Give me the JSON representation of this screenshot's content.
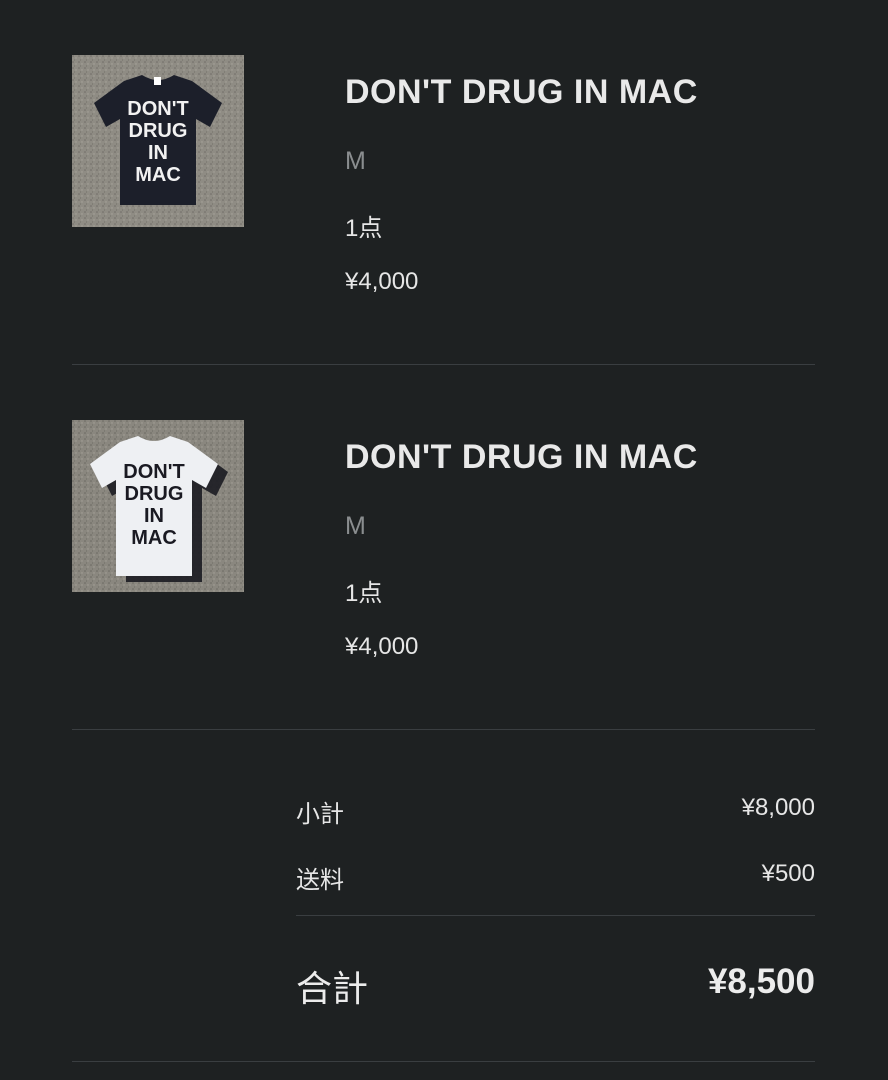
{
  "items": [
    {
      "name": "DON'T DRUG IN MAC",
      "variant": "M",
      "quantity": "1点",
      "price": "¥4,000",
      "shirt_color": "#1c1f2a",
      "print_color": "#f2f2f2",
      "shirt_print": [
        "DON'T",
        "DRUG",
        "IN",
        "MAC"
      ]
    },
    {
      "name": "DON'T DRUG IN MAC",
      "variant": "M",
      "quantity": "1点",
      "price": "¥4,000",
      "shirt_color": "#eef0f3",
      "print_color": "#1a1a22",
      "shirt_print": [
        "DON'T",
        "DRUG",
        "IN",
        "MAC"
      ]
    }
  ],
  "summary": {
    "subtotal_label": "小計",
    "subtotal_value": "¥8,000",
    "shipping_label": "送料",
    "shipping_value": "¥500",
    "total_label": "合計",
    "total_value": "¥8,500"
  },
  "colors": {
    "background": "#1e2122",
    "divider": "#3a3e41",
    "muted_text": "#8a8d8f",
    "asphalt": "#8f8c84"
  }
}
